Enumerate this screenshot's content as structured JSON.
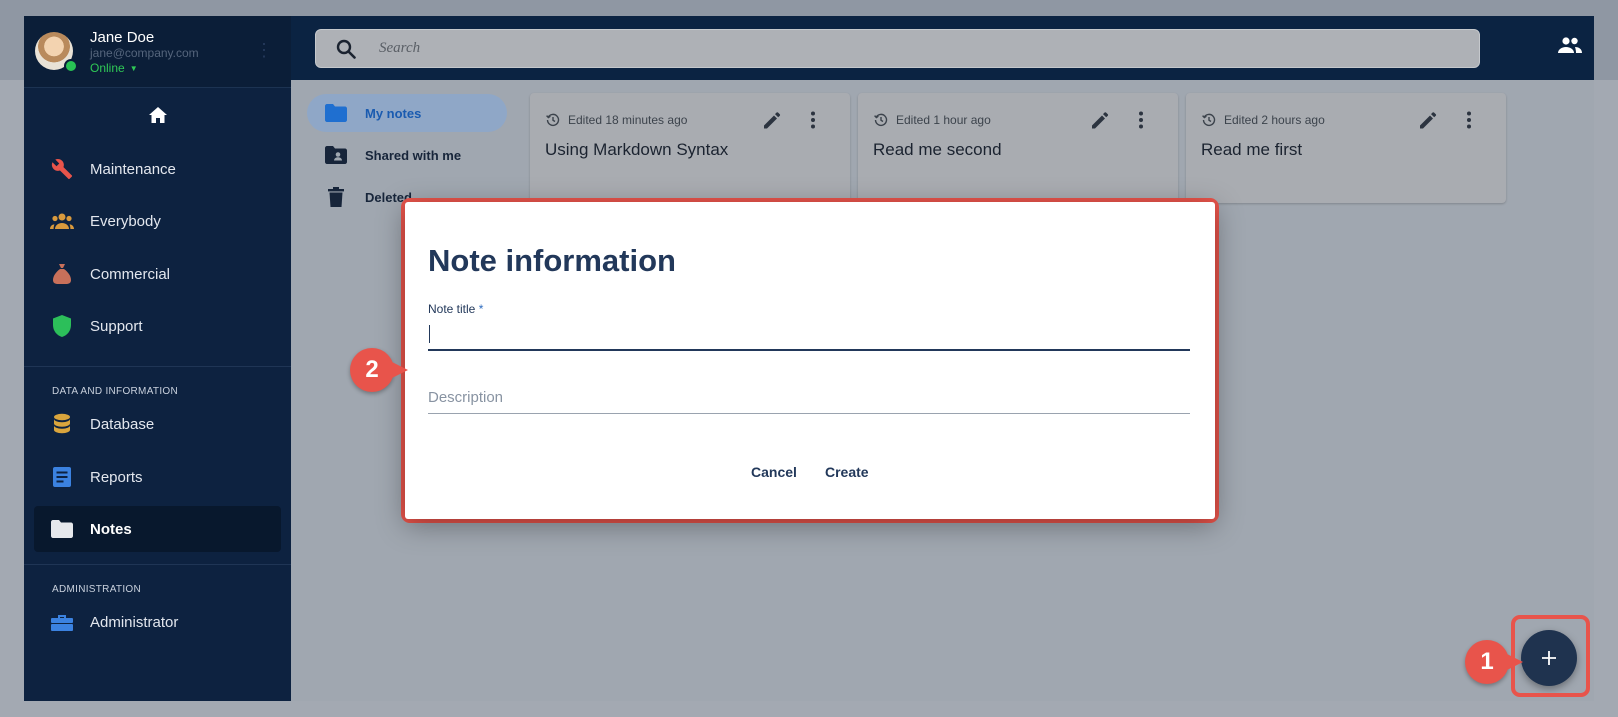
{
  "profile": {
    "name": "Jane Doe",
    "email": "jane@company.com",
    "status": "Online"
  },
  "sidebar": {
    "items": [
      {
        "label": "Maintenance",
        "icon": "wrench-icon",
        "color": "#e8544b"
      },
      {
        "label": "Everybody",
        "icon": "people-icon",
        "color": "#d99a3d"
      },
      {
        "label": "Commercial",
        "icon": "money-bag-icon",
        "color": "#c8705a"
      },
      {
        "label": "Support",
        "icon": "shield-icon",
        "color": "#2cbf5a"
      }
    ],
    "section_data": "DATA AND INFORMATION",
    "data_items": [
      {
        "label": "Database",
        "icon": "database-icon",
        "color": "#d9a53d"
      },
      {
        "label": "Reports",
        "icon": "document-icon",
        "color": "#3b82e0"
      },
      {
        "label": "Notes",
        "icon": "folder-icon",
        "color": "#e6e8ec"
      }
    ],
    "section_admin": "ADMINISTRATION",
    "admin_items": [
      {
        "label": "Administrator",
        "icon": "toolbox-icon",
        "color": "#3b82e0"
      }
    ],
    "active": "Notes"
  },
  "search": {
    "placeholder": "Search"
  },
  "notes_nav": [
    {
      "label": "My notes",
      "icon": "folder-icon",
      "active": true
    },
    {
      "label": "Shared with me",
      "icon": "shared-folder-icon",
      "active": false
    },
    {
      "label": "Deleted",
      "icon": "trash-icon",
      "active": false
    }
  ],
  "cards": [
    {
      "edited": "Edited 18 minutes ago",
      "title": "Using Markdown Syntax"
    },
    {
      "edited": "Edited 1 hour ago",
      "title": "Read me second"
    },
    {
      "edited": "Edited 2 hours ago",
      "title": "Read me first"
    }
  ],
  "dialog": {
    "title": "Note information",
    "note_title_label": "Note title",
    "required_mark": "*",
    "note_title_value": "",
    "description_placeholder": "Description",
    "cancel": "Cancel",
    "create": "Create"
  },
  "callouts": {
    "one": "1",
    "two": "2"
  },
  "fab": {
    "icon": "plus-icon"
  },
  "colors": {
    "sidebar_bg": "#0d2240",
    "accent": "#e8544b",
    "primary_text": "#22385a",
    "online": "#2fc956"
  }
}
